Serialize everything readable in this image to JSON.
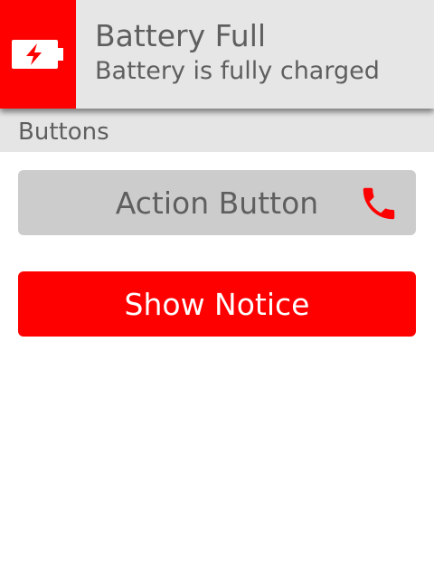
{
  "notification": {
    "icon": "battery-charging-icon",
    "title": "Battery Full",
    "body": "Battery is fully charged"
  },
  "section": {
    "title": "Buttons"
  },
  "buttons": {
    "action": {
      "label": "Action Button",
      "icon": "phone-icon"
    },
    "notice": {
      "label": "Show Notice"
    }
  },
  "colors": {
    "accent": "#ff0000",
    "button_gray": "#cccccc",
    "banner_bg": "#e6e6e6",
    "text_gray": "#5f5f5f"
  }
}
